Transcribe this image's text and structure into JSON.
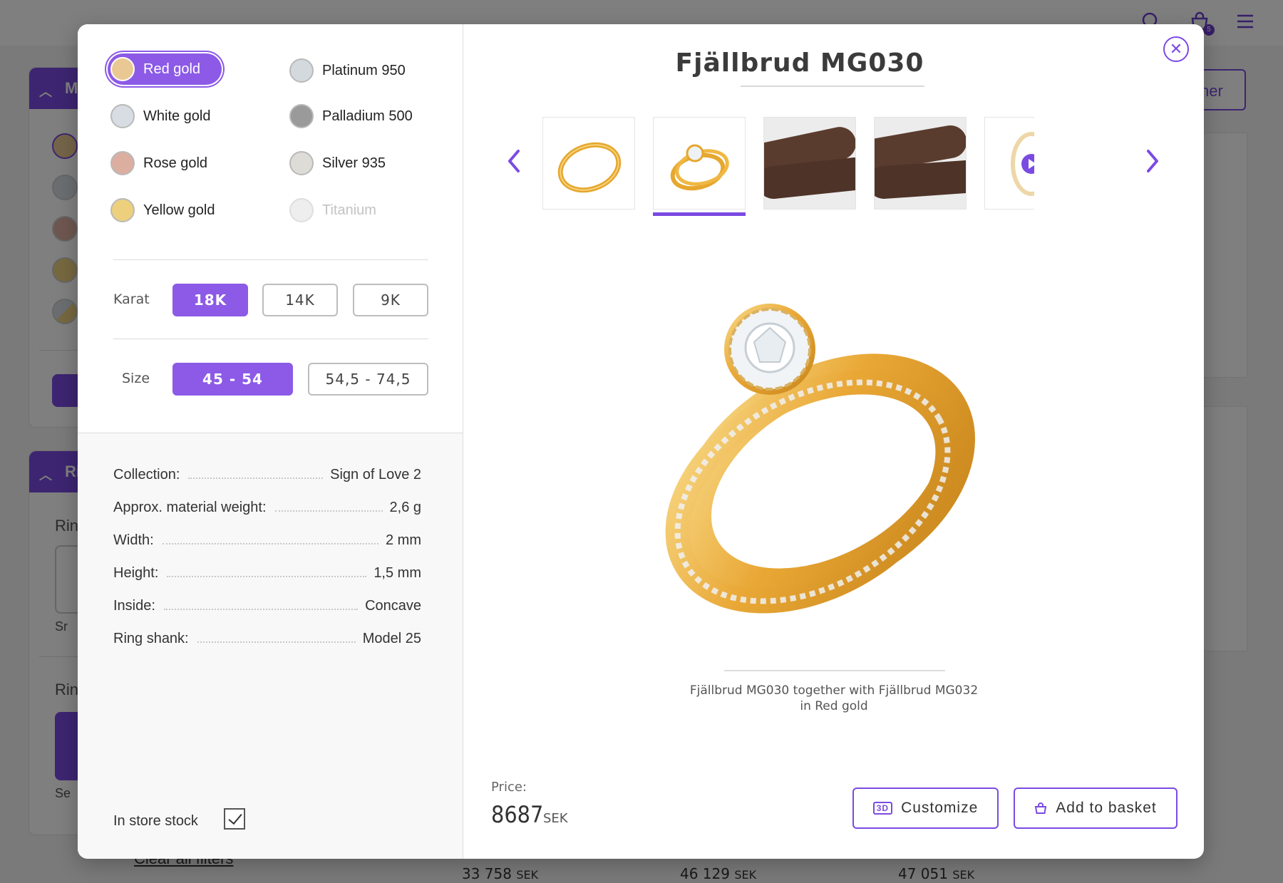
{
  "background": {
    "clear_filters": "Clear all filters",
    "other_button": "ner",
    "panel1_head": "M",
    "panel2_head": "Ri",
    "side_texts": [
      "Rin",
      "Rin",
      "Sr",
      "Se"
    ],
    "prices": [
      {
        "value": "33 758",
        "currency": "SEK"
      },
      {
        "value": "46 129",
        "currency": "SEK"
      },
      {
        "value": "47 051",
        "currency": "SEK"
      }
    ],
    "basket_count": "5"
  },
  "modal": {
    "close_label": "✕",
    "metals": [
      {
        "label": "Red gold",
        "color": "#e9c893"
      },
      {
        "label": "White gold",
        "color": "#d7dde2"
      },
      {
        "label": "Rose gold",
        "color": "#dcaea0"
      },
      {
        "label": "Yellow gold",
        "color": "#ecd07e"
      },
      {
        "label": "Platinum 950",
        "color": "#d4d9dd"
      },
      {
        "label": "Palladium 500",
        "color": "#9a9a9a"
      },
      {
        "label": "Silver 935",
        "color": "#dedcd6"
      },
      {
        "label": "Titanium",
        "color": "#eeeeee"
      }
    ],
    "karat": {
      "label": "Karat",
      "options": [
        "18K",
        "14K",
        "9K"
      ],
      "selected": "18K"
    },
    "size": {
      "label": "Size",
      "options": [
        "45 - 54",
        "54,5 - 74,5"
      ],
      "selected": "45 - 54"
    },
    "specs": [
      {
        "key": "Collection:",
        "value": "Sign of Love 2"
      },
      {
        "key": "Approx. material weight:",
        "value": "2,6 g"
      },
      {
        "key": "Width:",
        "value": "2 mm"
      },
      {
        "key": "Height:",
        "value": "1,5 mm"
      },
      {
        "key": "Inside:",
        "value": "Concave"
      },
      {
        "key": "Ring shank:",
        "value": "Model 25"
      }
    ],
    "in_store_stock": {
      "label": "In store stock",
      "checked": true
    },
    "title": "Fjällbrud MG030",
    "gallery": {
      "prev_label": "‹",
      "next_label": "›",
      "thumbnails": [
        "ring-side-view",
        "ring-set-view",
        "hands-photo-1",
        "hands-photo-2",
        "video-thumbnail",
        "ring-partial"
      ],
      "active_index": 1
    },
    "caption_line1": "Fjällbrud MG030 together with Fjällbrud MG032",
    "caption_line2": "in Red gold",
    "price_label": "Price:",
    "price_value": "8687",
    "price_currency": "SEK",
    "customize_label": "Customize",
    "customize_icon_text": "3D",
    "add_to_basket_label": "Add to basket",
    "accent_color": "#7b4ae2"
  }
}
